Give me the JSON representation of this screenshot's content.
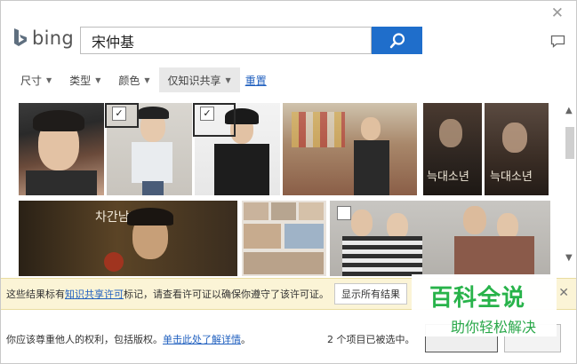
{
  "app": {
    "name": "bing"
  },
  "search": {
    "value": "宋仲基"
  },
  "filters": [
    {
      "label": "尺寸"
    },
    {
      "label": "类型"
    },
    {
      "label": "颜色"
    },
    {
      "label": "仅知识共享"
    }
  ],
  "reset_label": "重置",
  "image_overlay_text": [
    "차간남자",
    "늑대소년",
    "늑대소년"
  ],
  "notice": {
    "prefix": "这些结果标有",
    "link": "知识共享许可",
    "suffix": "标记，请查看许可证以确保你遵守了该许可证。",
    "button": "显示所有结果"
  },
  "footer": {
    "rights_text": "你应该尊重他人的权利，包括版权。",
    "rights_link": "单击此处了解详情",
    "rights_end": "。",
    "selected_count": "2 个项目已被选中。"
  },
  "watermark": {
    "title": "百科全说",
    "subtitle": "助你轻松解决"
  },
  "colors": {
    "accent": "#1f6ecb",
    "notice_bg": "#fbf4d6",
    "watermark": "#28b34a",
    "link": "#1f5fbf"
  },
  "icons": [
    "close-icon",
    "bing-logo-icon",
    "search-icon",
    "feedback-icon",
    "checkbox-icon",
    "scroll-up-icon",
    "scroll-down-icon"
  ]
}
